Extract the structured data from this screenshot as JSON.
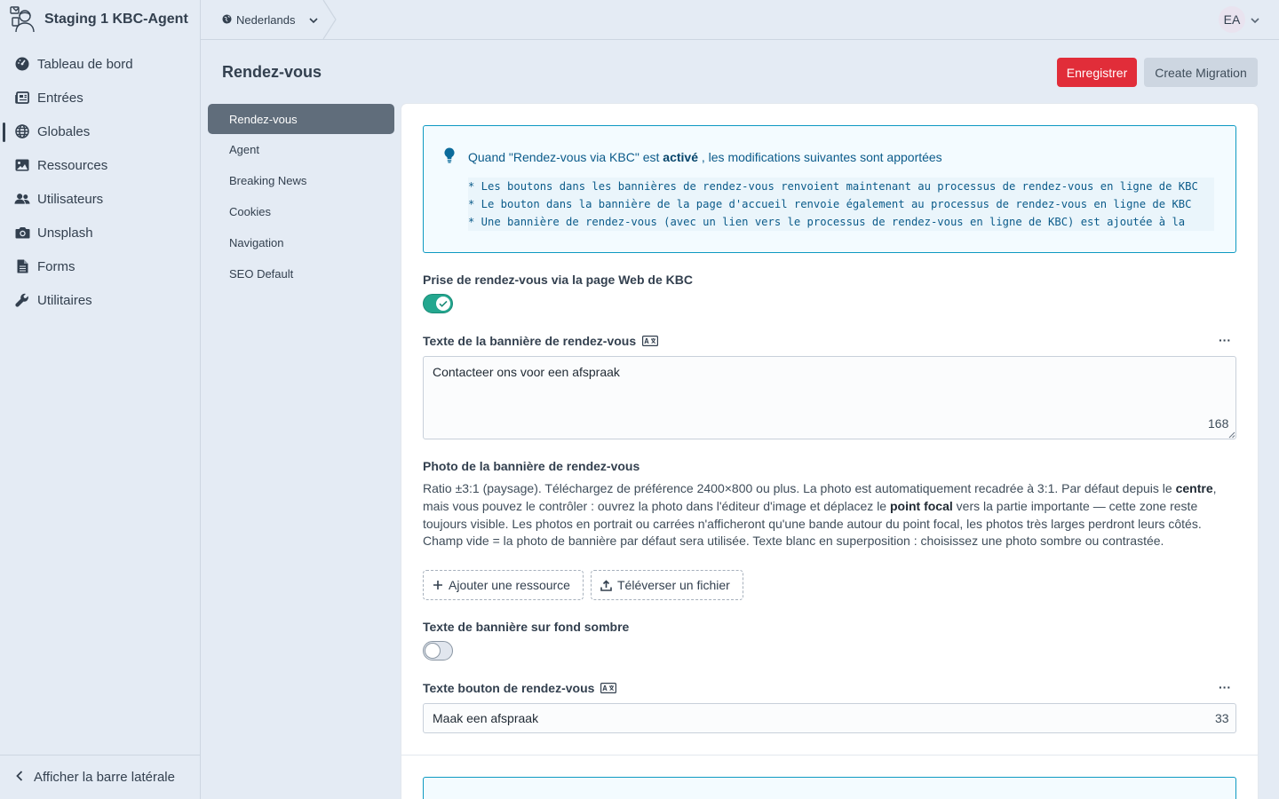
{
  "app": {
    "site_name": "Staging 1 KBC-Agent"
  },
  "sidebar": {
    "items": [
      {
        "label": "Tableau de bord",
        "icon": "dashboard-gauge-icon"
      },
      {
        "label": "Entrées",
        "icon": "newspaper-icon"
      },
      {
        "label": "Globales",
        "icon": "globe-icon",
        "active": true
      },
      {
        "label": "Ressources",
        "icon": "image-icon"
      },
      {
        "label": "Utilisateurs",
        "icon": "users-icon"
      },
      {
        "label": "Unsplash",
        "icon": "camera-icon"
      },
      {
        "label": "Forms",
        "icon": "document-icon"
      },
      {
        "label": "Utilitaires",
        "icon": "wrench-icon"
      }
    ],
    "footer_label": "Afficher la barre latérale"
  },
  "topbar": {
    "site_select": "Nederlands",
    "user_initials": "EA"
  },
  "header": {
    "title": "Rendez-vous",
    "save_label": "Enregistrer",
    "migrate_label": "Create Migration"
  },
  "subnav": {
    "items": [
      "Rendez-vous",
      "Agent",
      "Breaking News",
      "Cookies",
      "Navigation",
      "SEO Default"
    ],
    "active_index": 0
  },
  "tip": {
    "intro_before": "Quand \"Rendez-vous via KBC\" est ",
    "intro_bold": "activé",
    "intro_after": " , les modifications suivantes sont apportées",
    "code_lines": [
      "* Les boutons dans les bannières de rendez-vous renvoient maintenant au processus de rendez-vous en ligne de KBC",
      "* Le bouton dans la bannière de la page d'accueil renvoie également au processus de rendez-vous en ligne de KBC",
      "* Une bannière de rendez-vous (avec un lien vers le processus de rendez-vous en ligne de KBC) est ajoutée à la"
    ]
  },
  "fields": {
    "toggle1_label": "Prise de rendez-vous via la page Web de KBC",
    "toggle1_on": true,
    "banner_text_label": "Texte de la bannière de rendez-vous",
    "banner_text_value": "Contacteer ons voor een afspraak",
    "banner_text_count": "168",
    "photo_label": "Photo de la bannière de rendez-vous",
    "photo_desc": {
      "p1": "Ratio ±3:1 (paysage). Téléchargez de préférence 2400×800 ou plus. La photo est automatiquement recadrée à 3:1. Par défaut depuis le ",
      "b1": "centre",
      "p2": ", mais vous pouvez le contrôler : ouvrez la photo dans l'éditeur d'image et déplacez le ",
      "b2": "point focal",
      "p3": " vers la partie importante — cette zone reste toujours visible. Les photos en portrait ou carrées n'afficheront qu'une bande autour du point focal, les photos très larges perdront leurs côtés. Champ vide = la photo de bannière par défaut sera utilisée. Texte blanc en superposition : choisissez une photo sombre ou contrastée."
    },
    "add_resource_label": "Ajouter une ressource",
    "upload_label": "Téléverser un fichier",
    "toggle2_label": "Texte de bannière sur fond sombre",
    "toggle2_on": false,
    "button_text_label": "Texte bouton de rendez-vous",
    "button_text_value": "Maak een afspraak",
    "button_text_count": "33",
    "more_label": "···"
  },
  "colors": {
    "primary_red": "#e12d39",
    "toggle_on": "#24a78f",
    "tip_border": "#0d99c2"
  }
}
